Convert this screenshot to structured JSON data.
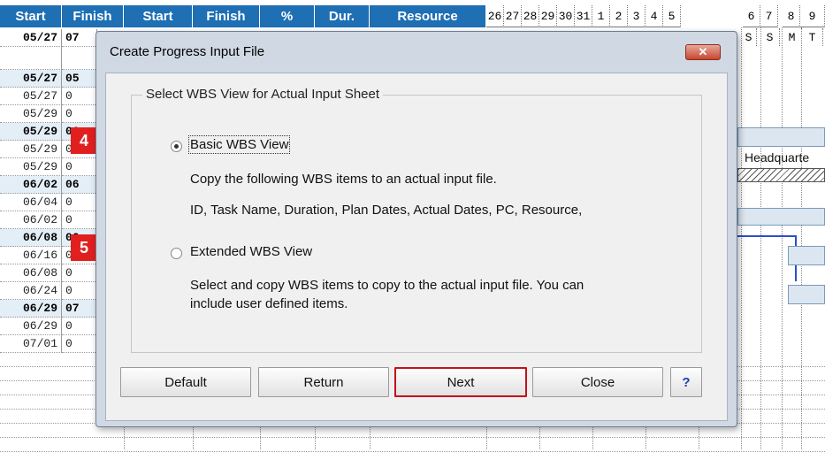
{
  "sheet": {
    "headers": [
      "Start",
      "Finish",
      "Start",
      "Finish",
      "%",
      "Dur.",
      "Resource"
    ],
    "days": [
      "26",
      "27",
      "28",
      "29",
      "30",
      "31",
      "1",
      "2",
      "3",
      "4",
      "5",
      "6",
      "7",
      "8",
      "9"
    ],
    "dow": [
      "S",
      "S",
      "M",
      "T"
    ],
    "col1": [
      "05/27",
      "",
      "05/27",
      "05/27",
      "05/29",
      "05/29",
      "05/29",
      "05/29",
      "06/02",
      "06/04",
      "06/02",
      "06/08",
      "06/16",
      "06/08",
      "06/24",
      "06/29",
      "06/29",
      "07/01"
    ],
    "col2": [
      "07",
      "",
      "05",
      "0",
      "0",
      "06",
      "0",
      "0",
      "06",
      "0",
      "0",
      "06",
      "0",
      "0",
      "0",
      "07",
      "0",
      "0"
    ],
    "bar_label": "Headquarte"
  },
  "dialog": {
    "title": "Create Progress Input File",
    "close_glyph": "✕",
    "group_label": "Select WBS View for Actual Input Sheet",
    "option_basic": "Basic WBS View",
    "basic_desc1": "Copy the following WBS items to an actual input file.",
    "basic_desc2": "ID, Task Name, Duration, Plan Dates, Actual Dates, PC, Resource,",
    "option_extended": "Extended WBS View",
    "extended_desc1": "Select and copy WBS items to copy to the actual input file. You can",
    "extended_desc2": "include user defined items.",
    "selected_option": "Basic WBS View",
    "buttons": {
      "default": "Default",
      "return": "Return",
      "next": "Next",
      "close": "Close",
      "help": "?"
    }
  },
  "callouts": {
    "step4": "4",
    "step5": "5"
  },
  "colors": {
    "header_blue": "#1e6fb3",
    "callout_red": "#e21f1f",
    "next_border": "#c3121a"
  }
}
